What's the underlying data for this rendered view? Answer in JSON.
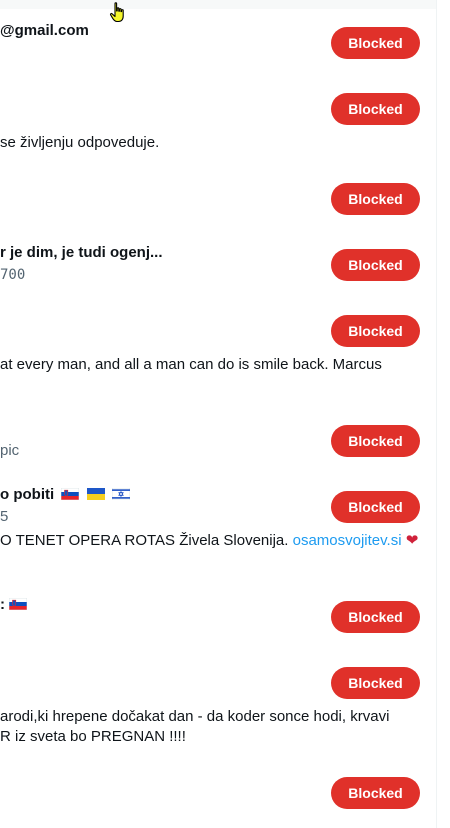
{
  "button_label": "Blocked",
  "accounts": [
    {
      "name": "@gmail.com",
      "handle": "",
      "bio": ""
    },
    {
      "name": "",
      "handle": "",
      "bio": "se življenju odpoveduje."
    },
    {
      "name": "",
      "handle": "",
      "bio": ""
    },
    {
      "name": "r je dim, je tudi ogenj...",
      "handle": "700",
      "bio": ""
    },
    {
      "name": "",
      "handle": "",
      "bio": "at every man, and all a man can do is smile back. Marcus"
    },
    {
      "name": "",
      "handle": "pic",
      "bio": ""
    },
    {
      "name": "o pobiti",
      "handle": "5",
      "bio": "O TENET OPERA ROTAS Živela Slovenija.",
      "bio_link": "osamosvojitev.si"
    },
    {
      "name": ":",
      "handle": "",
      "bio": ""
    },
    {
      "name": "",
      "handle": "",
      "bio": "arodi,ki hrepene dočakat dan - da koder sonce hodi, krvavi",
      "bio2": "R iz sveta bo PREGNAN !!!!"
    },
    {
      "name": "",
      "handle": "",
      "bio": ""
    }
  ],
  "icons": {
    "cursor": "hand-pointer-icon",
    "heart": "red-heart-icon",
    "flags": [
      "slovenia-flag-icon",
      "ukraine-flag-icon",
      "israel-flag-icon"
    ]
  },
  "colors": {
    "blocked_button": "#e0312a",
    "link": "#1d9bf0",
    "muted": "#536471"
  }
}
